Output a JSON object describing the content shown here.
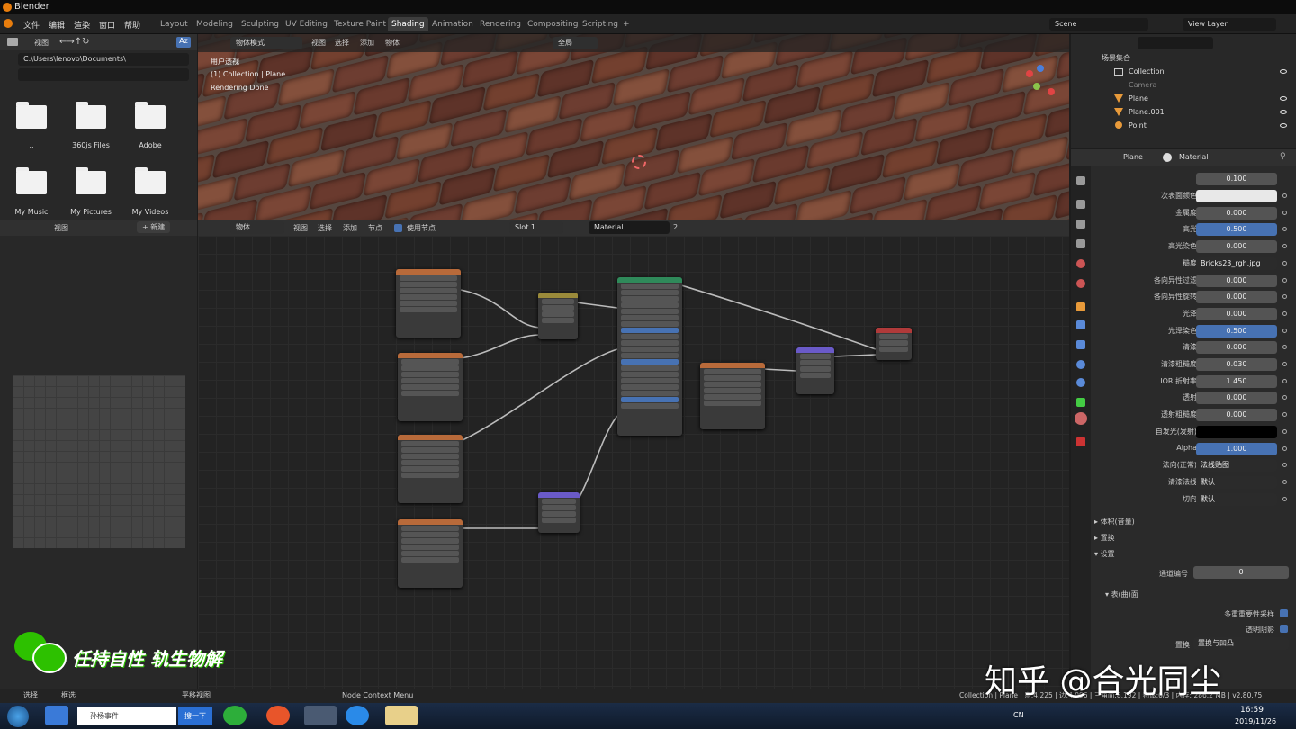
{
  "app": {
    "title": "Blender"
  },
  "menu": [
    "文件",
    "编辑",
    "渲染",
    "窗口",
    "帮助"
  ],
  "tabs": [
    "Layout",
    "Modeling",
    "Sculpting",
    "UV Editing",
    "Texture Paint",
    "Shading",
    "Animation",
    "Rendering",
    "Compositing",
    "Scripting"
  ],
  "active_tab": "Shading",
  "scene": {
    "label": "Scene",
    "view_layer": "View Layer"
  },
  "file_browser": {
    "view": "视图",
    "path": "C:\\Users\\lenovo\\Documents\\",
    "items": [
      "..",
      "360js Files",
      "Adobe",
      "My Music",
      "My Pictures",
      "My Videos"
    ]
  },
  "viewport": {
    "mode": "物体模式",
    "menu": [
      "视图",
      "选择",
      "添加",
      "物体"
    ],
    "global": "全局",
    "info": [
      "用户透视",
      "(1) Collection | Plane",
      "Rendering Done"
    ]
  },
  "node_editor": {
    "type": "物体",
    "menu": [
      "视图",
      "选择",
      "添加",
      "节点"
    ],
    "use_nodes": "使用节点",
    "slot": "Slot 1",
    "material": "Material",
    "users": "2"
  },
  "image_editor": {
    "view": "视图",
    "new": "新建"
  },
  "outliner": {
    "root": "场景集合",
    "items": [
      "Collection",
      "Camera",
      "Plane",
      "Plane.001",
      "Point"
    ]
  },
  "properties": {
    "object": "Plane",
    "material": "Material",
    "top_value": "0.100",
    "rows": [
      {
        "label": "次表面颜色",
        "value": "",
        "kind": "white"
      },
      {
        "label": "金属度",
        "value": "0.000",
        "kind": "num"
      },
      {
        "label": "高光",
        "value": "0.500",
        "kind": "blue"
      },
      {
        "label": "高光染色",
        "value": "0.000",
        "kind": "num"
      },
      {
        "label": "糙度",
        "value": "Bricks23_rgh.jpg",
        "kind": "text"
      },
      {
        "label": "各向异性过滤",
        "value": "0.000",
        "kind": "num"
      },
      {
        "label": "各向异性旋转",
        "value": "0.000",
        "kind": "num"
      },
      {
        "label": "光泽",
        "value": "0.000",
        "kind": "num"
      },
      {
        "label": "光泽染色",
        "value": "0.500",
        "kind": "blue"
      },
      {
        "label": "清漆",
        "value": "0.000",
        "kind": "num"
      },
      {
        "label": "清漆粗糙度",
        "value": "0.030",
        "kind": "num"
      },
      {
        "label": "IOR 折射率",
        "value": "1.450",
        "kind": "num"
      },
      {
        "label": "透射",
        "value": "0.000",
        "kind": "num"
      },
      {
        "label": "透射粗糙度",
        "value": "0.000",
        "kind": "num"
      },
      {
        "label": "自发光(发射)",
        "value": "",
        "kind": "black"
      },
      {
        "label": "Alpha",
        "value": "1.000",
        "kind": "blue"
      },
      {
        "label": "法向(正常)",
        "value": "法线贴图",
        "kind": "text"
      },
      {
        "label": "清漆法线",
        "value": "默认",
        "kind": "text"
      },
      {
        "label": "切向",
        "value": "默认",
        "kind": "text"
      }
    ],
    "sections": [
      "体积(音量)",
      "置换",
      "设置"
    ],
    "pass_index_label": "通道编号",
    "pass_index": "0",
    "surface": "表(曲)面",
    "multi_sample": "多重重要性采样",
    "transparent_shadow": "透明阴影",
    "displacement_label": "置换",
    "displacement_value": "置换与凹凸"
  },
  "status": {
    "select": "选择",
    "box": "框选",
    "pan": "平移视图",
    "context": "Node Context Menu",
    "stats": "Collection | Plane | 点:4,225 | 边:4,096 | 三角面:8,192 | 物体:0/3 | 内存: 286.2 MB | v2.80.75"
  },
  "taskbar": {
    "app_text": "孙杨事件",
    "search_btn": "搜一下",
    "time": "16:59",
    "date": "2019/11/26",
    "ime": "CN"
  },
  "overlay": {
    "watermark": "知乎 @合光同尘",
    "wechat_text": "任持自性 轨生物解"
  }
}
